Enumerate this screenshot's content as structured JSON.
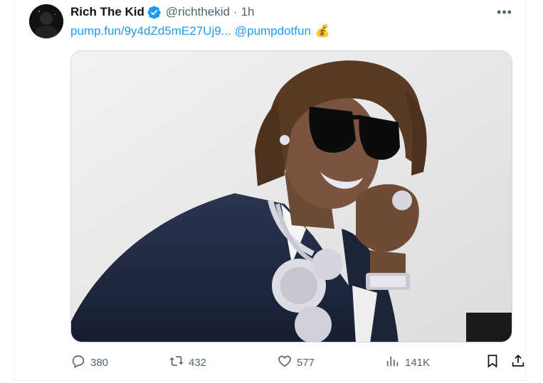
{
  "tweet": {
    "display_name": "Rich The Kid",
    "handle": "@richthekid",
    "separator": "·",
    "time": "1h",
    "more_label": "•••",
    "link_text": "pump.fun/9y4dZd5mE27Uj9...",
    "mention": "@pumpdotfun",
    "emoji": "💰",
    "media_alt": "Photo of Rich The Kid in sunglasses, navy suit and diamond chains, resting chin on fist"
  },
  "actions": {
    "replies": "380",
    "reposts": "432",
    "likes": "577",
    "views": "141K"
  },
  "icons": {
    "verified": "verified-badge-icon",
    "more": "more-icon",
    "reply": "reply-icon",
    "repost": "repost-icon",
    "like": "like-icon",
    "views": "views-icon",
    "bookmark": "bookmark-icon",
    "share": "share-icon"
  },
  "colors": {
    "link": "#1d9bf0",
    "secondary_text": "#536471",
    "verified": "#1d9bf0"
  }
}
